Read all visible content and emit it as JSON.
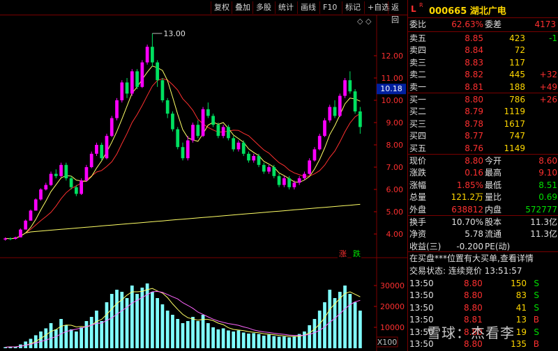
{
  "toolbar": {
    "buttons": [
      "复权",
      "叠加",
      "多股",
      "统计",
      "画线",
      "F10",
      "标记",
      "+自选",
      "返回"
    ]
  },
  "stock": {
    "market_letter": "L",
    "rank_letter": "R",
    "code_name": "000665 湖北广电"
  },
  "weibi": {
    "label1": "委比",
    "val1": "62.63%",
    "label2": "委差",
    "val2": "4173"
  },
  "sell": [
    {
      "label": "卖五",
      "price": "8.85",
      "vol": "423",
      "chg": "-1",
      "chg_color": "green"
    },
    {
      "label": "卖四",
      "price": "8.84",
      "vol": "72",
      "chg": "",
      "chg_color": "red"
    },
    {
      "label": "卖三",
      "price": "8.83",
      "vol": "117",
      "chg": "",
      "chg_color": "red"
    },
    {
      "label": "卖二",
      "price": "8.82",
      "vol": "445",
      "chg": "+32",
      "chg_color": "red"
    },
    {
      "label": "卖一",
      "price": "8.81",
      "vol": "188",
      "chg": "+49",
      "chg_color": "red"
    }
  ],
  "buy": [
    {
      "label": "买一",
      "price": "8.80",
      "vol": "786",
      "chg": "+26"
    },
    {
      "label": "买二",
      "price": "8.79",
      "vol": "1119",
      "chg": ""
    },
    {
      "label": "买三",
      "price": "8.78",
      "vol": "1617",
      "chg": ""
    },
    {
      "label": "买四",
      "price": "8.77",
      "vol": "747",
      "chg": ""
    },
    {
      "label": "买五",
      "price": "8.76",
      "vol": "1149",
      "chg": ""
    }
  ],
  "quote": [
    {
      "l1": "现价",
      "v1": "8.80",
      "c1": "red",
      "l2": "今开",
      "v2": "8.60",
      "c2": "red"
    },
    {
      "l1": "涨跌",
      "v1": "0.16",
      "c1": "red",
      "l2": "最高",
      "v2": "9.10",
      "c2": "red"
    },
    {
      "l1": "涨幅",
      "v1": "1.85%",
      "c1": "red",
      "l2": "最低",
      "v2": "8.51",
      "c2": "green"
    },
    {
      "l1": "总量",
      "v1": "121.2万",
      "c1": "yellow",
      "l2": "量比",
      "v2": "0.69",
      "c2": "green"
    },
    {
      "l1": "外盘",
      "v1": "638812",
      "c1": "red",
      "l2": "内盘",
      "v2": "572777",
      "c2": "green"
    }
  ],
  "fund": [
    {
      "l1": "换手",
      "v1": "10.70%",
      "l2": "股本",
      "v2": "11.3亿"
    },
    {
      "l1": "净资",
      "v1": "5.78",
      "l2": "流通",
      "v2": "11.3亿"
    },
    {
      "l1": "收益(三)",
      "v1": "-0.200",
      "l2": "PE(动)",
      "v2": ""
    }
  ],
  "notice": "在买盘***位置有大买单,查看详情",
  "trade_status": "交易状态: 连续竞价 13:51:57",
  "ticks": [
    {
      "time": "13:50",
      "price": "8.80",
      "vol": "150",
      "flag": "S"
    },
    {
      "time": "13:50",
      "price": "8.80",
      "vol": "83",
      "flag": "S"
    },
    {
      "time": "13:50",
      "price": "8.80",
      "vol": "41",
      "flag": "S"
    },
    {
      "time": "13:50",
      "price": "8.81",
      "vol": "13",
      "flag": "B"
    },
    {
      "time": "13:50",
      "price": "8.80",
      "vol": "19",
      "flag": "S"
    },
    {
      "time": "13:50",
      "price": "8.80",
      "vol": "135",
      "flag": "B"
    }
  ],
  "watermark": "雪球：杰看李",
  "chart": {
    "price_ticks": [
      "12.00",
      "11.00",
      "10.00",
      "9.00",
      "8.00",
      "7.00",
      "6.00",
      "5.00",
      "4.00"
    ],
    "current_price": "10.18",
    "high_label": "13.00",
    "vol_ticks": [
      "30000",
      "20000",
      "10000"
    ],
    "vol_unit": "X100",
    "zhang": "涨",
    "die": "跌",
    "colors": {
      "up": "#ff00ff",
      "down": "#00e060",
      "vol": "#80ffff",
      "ma5": "#ffff66",
      "ma10": "#ff3030",
      "ma60": "#ffff66"
    }
  },
  "chart_data": {
    "type": "candlestick",
    "price_range": [
      3.5,
      13.5
    ],
    "volume_range": [
      0,
      32000
    ],
    "candles": [
      [
        3.75,
        3.8,
        3.85,
        3.7
      ],
      [
        3.8,
        3.78,
        3.85,
        3.72
      ],
      [
        3.78,
        3.85,
        3.88,
        3.75
      ],
      [
        3.85,
        4.2,
        4.25,
        3.85
      ],
      [
        4.2,
        4.6,
        4.65,
        4.2
      ],
      [
        4.6,
        5.05,
        5.1,
        4.6
      ],
      [
        5.05,
        5.55,
        5.6,
        5.05
      ],
      [
        5.55,
        6.0,
        6.05,
        5.5
      ],
      [
        6.0,
        6.2,
        6.3,
        5.95
      ],
      [
        6.2,
        6.7,
        6.8,
        6.15
      ],
      [
        6.7,
        6.6,
        6.9,
        6.5
      ],
      [
        6.6,
        7.1,
        7.2,
        6.55
      ],
      [
        7.1,
        6.5,
        7.2,
        6.4
      ],
      [
        6.5,
        6.1,
        6.6,
        6.0
      ],
      [
        6.1,
        5.8,
        6.2,
        5.7
      ],
      [
        5.8,
        6.4,
        6.5,
        5.75
      ],
      [
        6.4,
        7.0,
        7.1,
        6.35
      ],
      [
        7.0,
        7.6,
        7.7,
        6.95
      ],
      [
        7.6,
        8.0,
        8.1,
        7.5
      ],
      [
        8.0,
        7.4,
        8.1,
        7.3
      ],
      [
        7.4,
        8.4,
        8.5,
        7.35
      ],
      [
        8.4,
        9.2,
        9.3,
        8.35
      ],
      [
        9.2,
        10.0,
        10.1,
        9.1
      ],
      [
        10.0,
        10.8,
        10.9,
        9.9
      ],
      [
        10.8,
        10.3,
        11.0,
        10.1
      ],
      [
        10.3,
        11.3,
        11.4,
        10.2
      ],
      [
        11.3,
        10.6,
        11.4,
        10.5
      ],
      [
        10.6,
        11.7,
        11.8,
        10.55
      ],
      [
        11.7,
        12.4,
        12.5,
        11.6
      ],
      [
        12.4,
        11.7,
        13.0,
        11.5
      ],
      [
        11.7,
        10.9,
        11.8,
        10.6
      ],
      [
        10.9,
        10.0,
        11.0,
        9.9
      ],
      [
        10.0,
        9.4,
        10.1,
        9.2
      ],
      [
        9.4,
        8.7,
        9.5,
        8.6
      ],
      [
        8.7,
        7.9,
        8.8,
        7.8
      ],
      [
        7.9,
        7.4,
        8.1,
        7.3
      ],
      [
        7.4,
        8.2,
        8.4,
        7.3
      ],
      [
        8.2,
        8.9,
        9.0,
        8.1
      ],
      [
        8.9,
        8.4,
        9.1,
        8.3
      ],
      [
        8.4,
        9.6,
        9.7,
        8.35
      ],
      [
        9.6,
        9.3,
        9.9,
        9.2
      ],
      [
        9.3,
        8.9,
        9.4,
        8.8
      ],
      [
        8.9,
        8.4,
        9.0,
        8.3
      ],
      [
        8.4,
        8.8,
        8.9,
        8.3
      ],
      [
        8.8,
        8.3,
        8.9,
        8.2
      ],
      [
        8.3,
        7.8,
        8.4,
        7.7
      ],
      [
        7.8,
        8.1,
        8.2,
        7.7
      ],
      [
        8.1,
        7.6,
        8.2,
        7.5
      ],
      [
        7.6,
        7.3,
        7.7,
        7.2
      ],
      [
        7.3,
        7.5,
        7.6,
        7.2
      ],
      [
        7.5,
        7.1,
        7.6,
        7.0
      ],
      [
        7.1,
        6.8,
        7.2,
        6.7
      ],
      [
        6.8,
        7.0,
        7.1,
        6.7
      ],
      [
        7.0,
        6.6,
        7.1,
        6.5
      ],
      [
        6.6,
        6.2,
        6.7,
        6.1
      ],
      [
        6.2,
        6.5,
        6.6,
        6.1
      ],
      [
        6.5,
        6.1,
        6.6,
        6.0
      ],
      [
        6.1,
        6.3,
        6.4,
        6.0
      ],
      [
        6.3,
        6.5,
        6.6,
        6.2
      ],
      [
        6.5,
        6.7,
        6.8,
        6.4
      ],
      [
        6.7,
        7.3,
        7.4,
        6.65
      ],
      [
        7.3,
        7.8,
        7.9,
        7.25
      ],
      [
        7.8,
        8.4,
        8.5,
        7.75
      ],
      [
        8.4,
        9.1,
        9.2,
        8.35
      ],
      [
        9.1,
        9.7,
        9.8,
        9.0
      ],
      [
        9.7,
        9.3,
        10.0,
        9.2
      ],
      [
        9.3,
        10.2,
        10.3,
        9.25
      ],
      [
        10.2,
        10.9,
        11.0,
        10.1
      ],
      [
        10.9,
        10.4,
        11.3,
        10.3
      ],
      [
        10.4,
        9.5,
        10.5,
        9.4
      ],
      [
        9.5,
        8.8,
        9.7,
        8.5
      ]
    ],
    "volumes": [
      500,
      800,
      700,
      1800,
      3200,
      4500,
      6200,
      8000,
      9500,
      12000,
      9000,
      14000,
      11000,
      9000,
      8000,
      10000,
      13000,
      15000,
      18000,
      13000,
      22000,
      26000,
      28000,
      27000,
      24000,
      30000,
      26000,
      29000,
      31000,
      27000,
      24000,
      21000,
      18000,
      16000,
      14000,
      12000,
      13000,
      15000,
      13000,
      16000,
      12000,
      10000,
      9000,
      9500,
      8500,
      8000,
      8500,
      7500,
      7000,
      7200,
      6800,
      6000,
      6500,
      5800,
      5500,
      5600,
      5200,
      5800,
      6800,
      8000,
      11000,
      14000,
      18000,
      22000,
      28000,
      24000,
      27000,
      30000,
      26000,
      22000,
      18000
    ]
  }
}
